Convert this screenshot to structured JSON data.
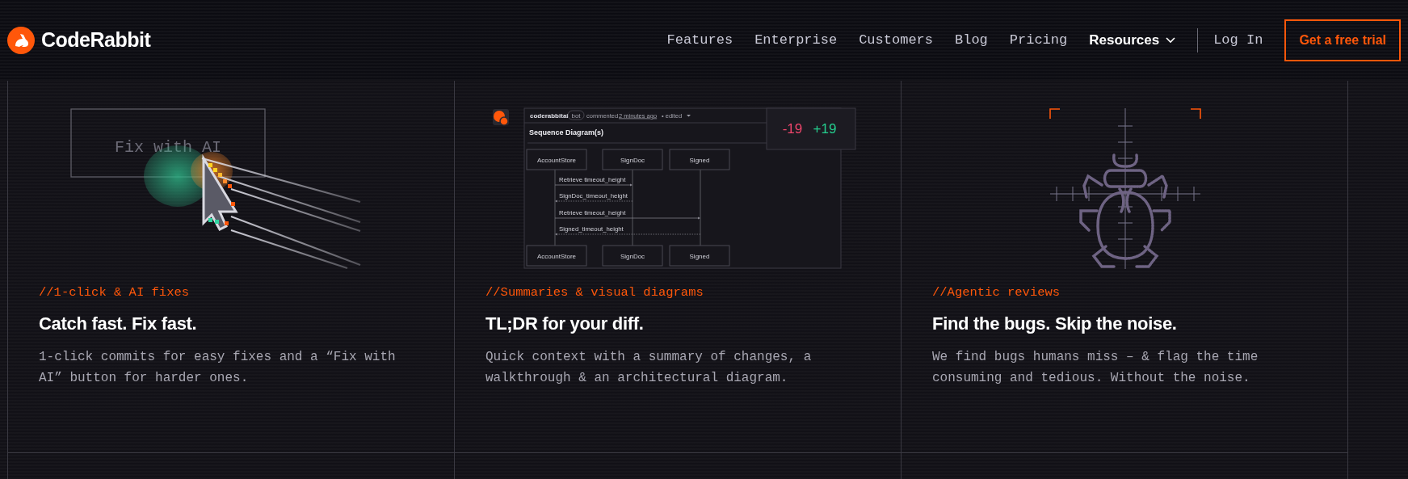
{
  "brand": {
    "name": "CodeRabbit"
  },
  "nav": {
    "items": [
      {
        "label": "Features",
        "kind": "link"
      },
      {
        "label": "Enterprise",
        "kind": "link"
      },
      {
        "label": "Customers",
        "kind": "link"
      },
      {
        "label": "Blog",
        "kind": "link"
      },
      {
        "label": "Pricing",
        "kind": "link"
      },
      {
        "label": "Resources",
        "kind": "dropdown"
      }
    ],
    "login": "Log In",
    "cta": "Get a free trial"
  },
  "features": [
    {
      "tag": "//1-click & AI fixes",
      "title": "Catch fast. Fix fast.",
      "text": "1-click commits for easy fixes and a “Fix with AI” button for harder ones.",
      "art": {
        "kind": "fix-button",
        "button_label": "Fix with AI"
      }
    },
    {
      "tag": "//Summaries & visual diagrams",
      "title": "TL;DR for your diff.",
      "text": "Quick context with a summary of changes, a walkthrough & an architectural diagram.",
      "art": {
        "kind": "sequence-diagram",
        "author": "coderabbitai",
        "badge": "bot",
        "action": "commented",
        "time": "2 minutes ago",
        "edited": "• edited",
        "heading": "Sequence Diagram(s)",
        "participants": [
          "AccountStore",
          "SignDoc",
          "Signed"
        ],
        "bottom_participants": [
          "AccountStore",
          "SignDoc",
          "Signed"
        ],
        "messages": [
          {
            "label": "Retrieve timeout_height",
            "kind": "call"
          },
          {
            "label": "SignDoc_timeout_height",
            "kind": "return"
          },
          {
            "label": "Retrieve timeout_height",
            "kind": "call"
          },
          {
            "label": "Signed_timeout_height",
            "kind": "return"
          }
        ],
        "removed": "-19",
        "added": "+19"
      }
    },
    {
      "tag": "//Agentic reviews",
      "title": "Find the bugs. Skip the noise.",
      "text": "We find bugs humans miss – & flag the time consuming and tedious. Without the noise.",
      "art": {
        "kind": "bug-target"
      }
    }
  ]
}
